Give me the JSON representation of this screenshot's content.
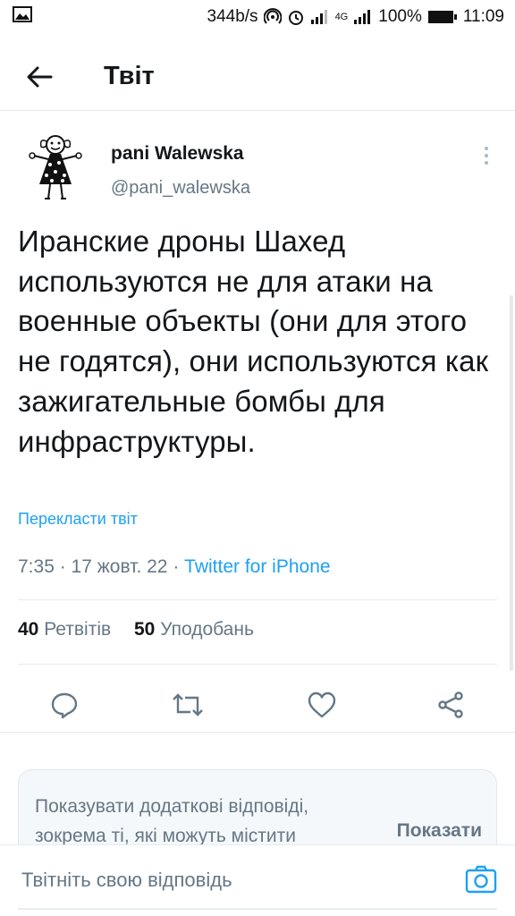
{
  "status_bar": {
    "net_speed": "344b/s",
    "battery": "100%",
    "time": "11:09",
    "network_type": "4G",
    "icons": [
      "image-icon",
      "hotspot-icon",
      "alarm-icon",
      "signal-icon",
      "battery-icon"
    ]
  },
  "header": {
    "title": "Твіт",
    "back_icon": "arrow-left-icon"
  },
  "tweet": {
    "author_name": "pani Walewska",
    "author_handle": "@pani_walewska",
    "text": "Иранские дроны Шахед используются не для атаки на военные объекты (они для этого не годятся), они используются как зажигательные бомбы для инфраструктуры.",
    "translate_label": "Перекласти твіт",
    "time": "7:35",
    "date": "17 жовт. 22",
    "source": "Twitter for iPhone",
    "retweets_count": "40",
    "retweets_label": "Ретвітів",
    "likes_count": "50",
    "likes_label": "Уподобань"
  },
  "actions": [
    "reply-icon",
    "retweet-icon",
    "like-icon",
    "share-icon"
  ],
  "more_replies": {
    "text": "Показувати додаткові відповіді, зокрема ті, які можуть містити",
    "button_label": "Показати"
  },
  "reply_bar": {
    "placeholder": "Твітніть свою відповідь"
  },
  "colors": {
    "accent": "#1da1f2",
    "text_primary": "#14171a",
    "text_secondary": "#657786",
    "divider": "#e6ecf0"
  }
}
